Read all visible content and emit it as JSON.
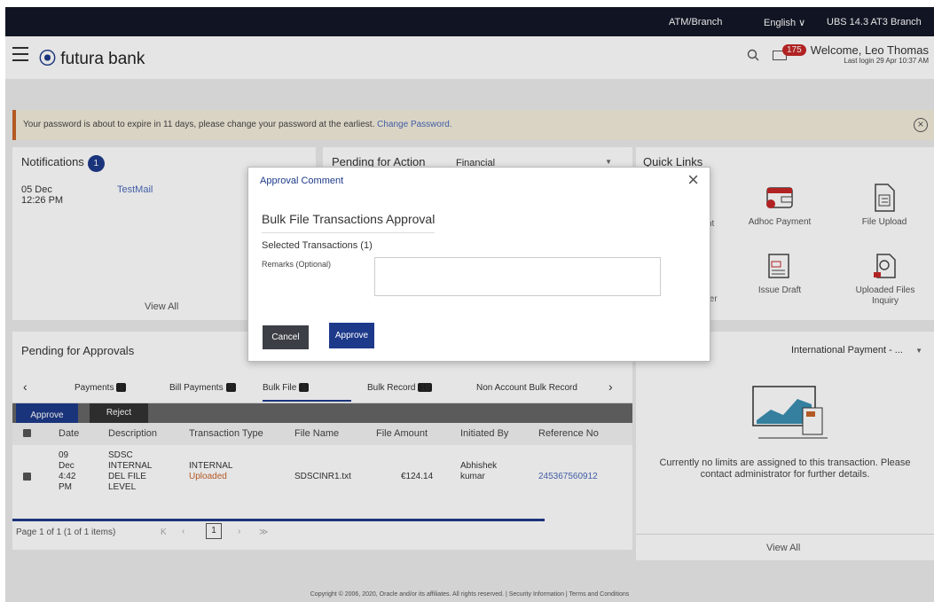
{
  "topbar": {
    "atm": "ATM/Branch",
    "lang": "English",
    "branch": "UBS 14.3 AT3 Branch"
  },
  "header": {
    "brand_prefix": "futura",
    "brand_suffix": " bank",
    "mail_count": "175",
    "welcome": "Welcome, Leo Thomas",
    "last_login": "Last login 29 Apr 10:37 AM"
  },
  "banner": {
    "message": "Your password is about to expire in 11 days, please change your password at the earliest.",
    "link": "Change Password."
  },
  "notifications": {
    "title": "Notifications",
    "count": "1",
    "date": "05 Dec",
    "time": "12:26 PM",
    "subject": "TestMail",
    "view_all": "View All"
  },
  "pending_action": {
    "title": "Pending for Action",
    "selected": "Financial"
  },
  "quick_links": {
    "title": "Quick Links",
    "partial1": "nt",
    "partial2": "fer",
    "items": [
      "Adhoc Payment",
      "File Upload",
      "Issue Draft",
      "Uploaded Files",
      "Inquiry"
    ]
  },
  "pending_approvals": {
    "title": "Pending for Approvals",
    "tabs": [
      {
        "label": "Payments",
        "count": "5"
      },
      {
        "label": "Bill Payments",
        "count": "0"
      },
      {
        "label": "Bulk File",
        "count": "1"
      },
      {
        "label": "Bulk Record",
        "count": "18"
      },
      {
        "label": "Non Account Bulk Record",
        "count": ""
      }
    ],
    "approve_label": "Approve",
    "reject_label": "Reject",
    "columns": [
      "Date",
      "Description",
      "Transaction Type",
      "File Name",
      "File Amount",
      "Initiated By",
      "Reference No"
    ],
    "row": {
      "date": [
        "09",
        "Dec",
        "4:42",
        "PM"
      ],
      "description": [
        "SDSC",
        "INTERNAL",
        "DEL FILE",
        "LEVEL"
      ],
      "type": "INTERNAL",
      "status": "Uploaded",
      "file_name": "SDSCINR1.txt",
      "amount": "€124.14",
      "initiated_by": [
        "Abhishek",
        "kumar"
      ],
      "reference": "245367560912"
    },
    "pager": {
      "text": "Page  1  of 1   (1 of 1 items)",
      "current": "1"
    }
  },
  "limits": {
    "selected": "International Payment - ...",
    "message": "Currently no limits are assigned to this transaction. Please contact administrator for further details.",
    "view_all": "View All"
  },
  "modal": {
    "header": "Approval Comment",
    "title": "Bulk File Transactions Approval",
    "selected": "Selected Transactions (1)",
    "remarks_label": "Remarks (Optional)",
    "remarks_value": "",
    "cancel_label": "Cancel",
    "approve_label": "Approve"
  },
  "footer": {
    "text": "Copyright © 2006, 2020, Oracle and/or its affiliates. All rights reserved. | Security Information | Terms and Conditions"
  },
  "colors": {
    "primary": "#1d3a8a",
    "dark": "#141827",
    "accent": "#c8642a",
    "link": "#4a69b8",
    "status": "#c8642a"
  }
}
